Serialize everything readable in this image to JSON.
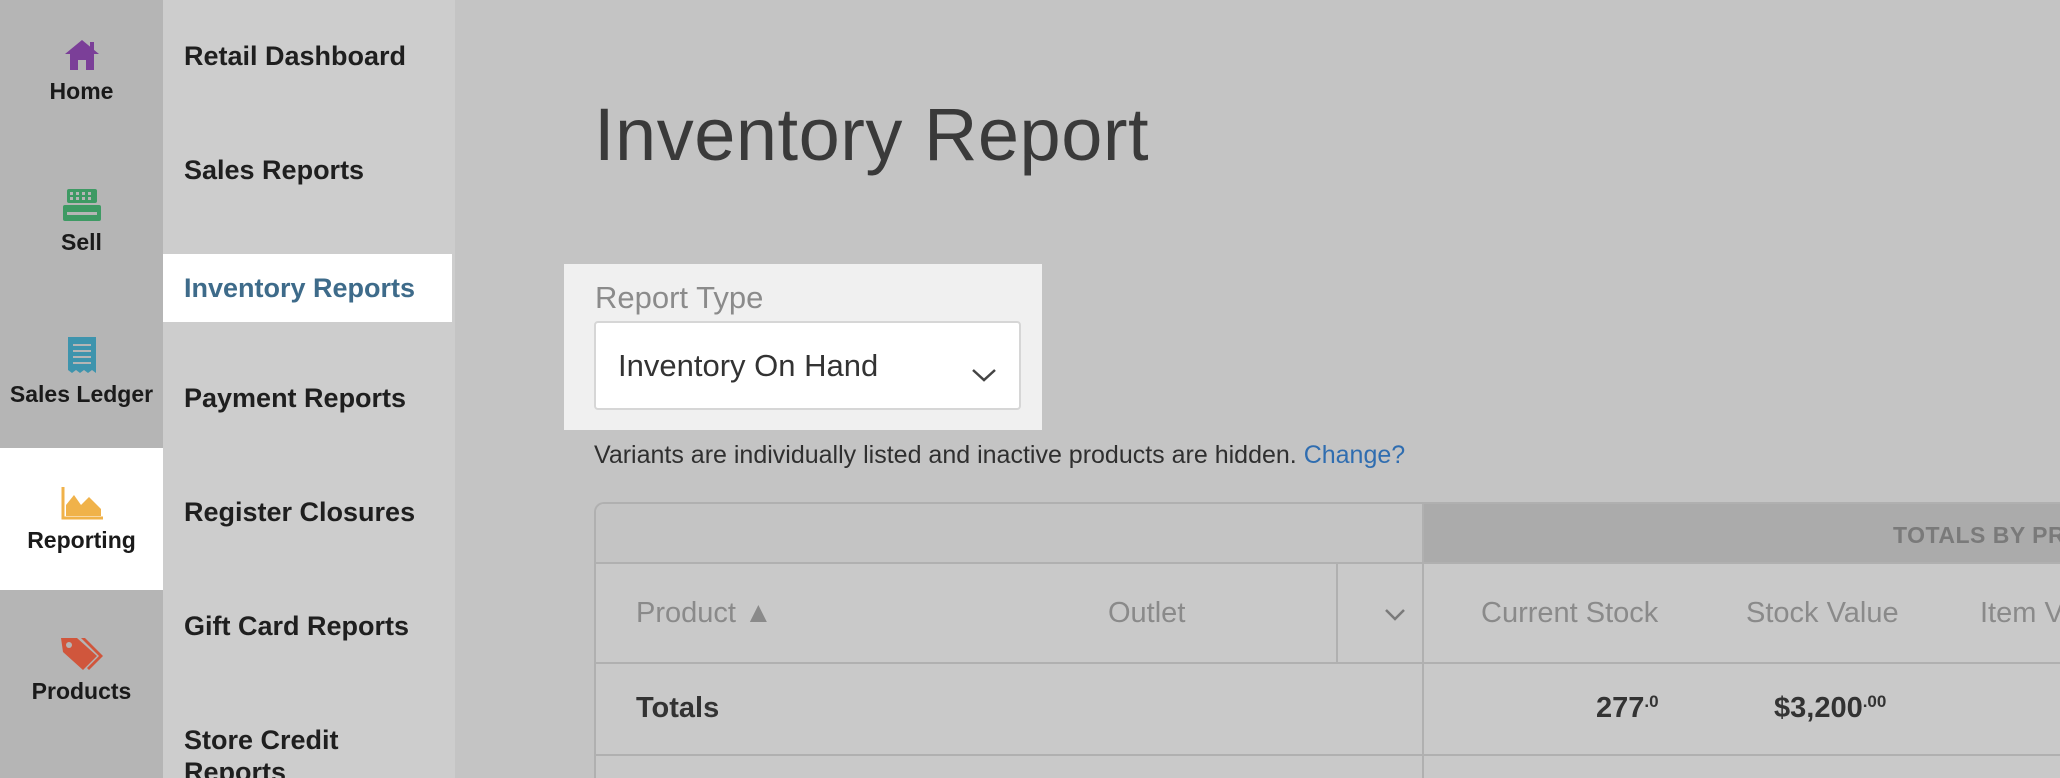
{
  "rail": {
    "items": [
      {
        "label": "Home",
        "icon": "home-icon",
        "color": "#7b3f98"
      },
      {
        "label": "Sell",
        "icon": "register-icon",
        "color": "#3e9a64"
      },
      {
        "label": "Sales Ledger",
        "icon": "receipt-icon",
        "color": "#3e94ad"
      },
      {
        "label": "Reporting",
        "icon": "chart-area-icon",
        "color": "#f0b24a",
        "active": true
      },
      {
        "label": "Products",
        "icon": "tags-icon",
        "color": "#d0563c"
      }
    ]
  },
  "subnav": {
    "items": [
      {
        "label": "Retail Dashboard"
      },
      {
        "label": "Sales Reports"
      },
      {
        "label": "Inventory Reports",
        "active": true
      },
      {
        "label": "Payment Reports"
      },
      {
        "label": "Register Closures"
      },
      {
        "label": "Gift Card Reports"
      },
      {
        "label": "Store Credit Reports"
      }
    ]
  },
  "page": {
    "title": "Inventory Report"
  },
  "report_type": {
    "label": "Report Type",
    "selected": "Inventory On Hand"
  },
  "note": {
    "text": "Variants are individually listed and inactive products are hidden.",
    "link": "Change?"
  },
  "table": {
    "group_header": "TOTALS BY PR",
    "columns": {
      "product": "Product ▲",
      "outlet": "Outlet",
      "current_stock": "Current Stock",
      "stock_value": "Stock Value",
      "item_value": "Item V"
    },
    "totals": {
      "label": "Totals",
      "current_stock_int": "277",
      "current_stock_dec": ".0",
      "stock_value_int": "$3,200",
      "stock_value_dec": ".00"
    }
  },
  "colors": {
    "accent_link": "#2f6db0",
    "active_nav_text": "#3e6b8a"
  }
}
